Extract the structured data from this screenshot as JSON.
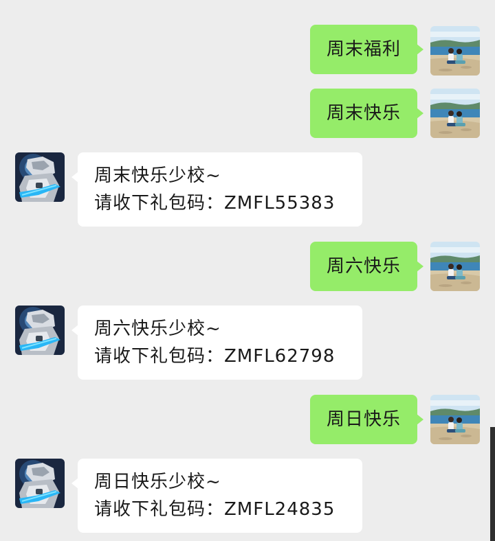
{
  "conversation": {
    "messages": [
      {
        "side": "right",
        "text": "周末福利"
      },
      {
        "side": "right",
        "text": "周末快乐"
      },
      {
        "side": "left",
        "line1": "周末快乐少校~",
        "line2": "请收下礼包码：ZMFL55383"
      },
      {
        "side": "right",
        "text": "周六快乐"
      },
      {
        "side": "left",
        "line1": "周六快乐少校~",
        "line2": "请收下礼包码：ZMFL62798"
      },
      {
        "side": "right",
        "text": "周日快乐"
      },
      {
        "side": "left",
        "line1": "周日快乐少校~",
        "line2": "请收下礼包码：ZMFL24835"
      }
    ]
  },
  "colors": {
    "background": "#ededed",
    "sent_bubble": "#95ec69",
    "received_bubble": "#ffffff",
    "text": "#191919"
  },
  "icons": {
    "self_avatar": "beach-couple-photo",
    "bot_avatar": "armored-robot-avatar"
  }
}
